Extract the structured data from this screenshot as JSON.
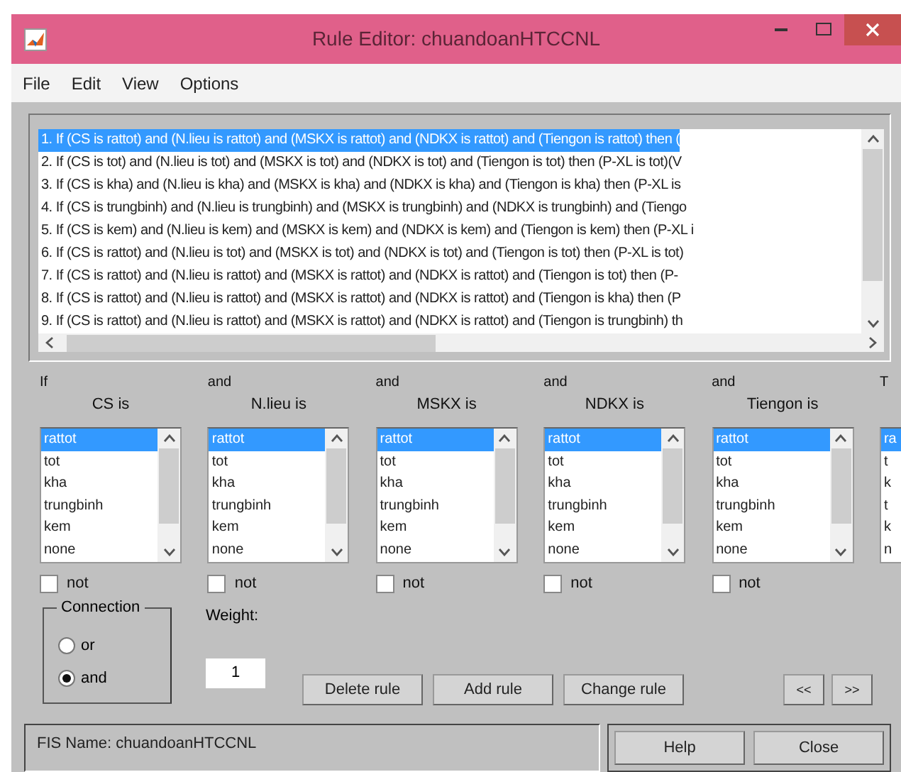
{
  "window": {
    "title": "Rule Editor: chuandoanHTCCNL"
  },
  "menu": [
    "File",
    "Edit",
    "View",
    "Options"
  ],
  "rules": [
    {
      "text": "1. If (CS is rattot) and (N.lieu is rattot) and (MSKX is rattot) and (NDKX is rattot) and (Tiengon is rattot) then (",
      "selected": true
    },
    {
      "text": "2. If (CS is tot) and (N.lieu is tot) and (MSKX is tot) and (NDKX is tot) and (Tiengon is tot) then (P-XL is tot)(V",
      "selected": false
    },
    {
      "text": "3. If (CS is kha) and (N.lieu is kha) and (MSKX is kha) and (NDKX is kha) and (Tiengon is kha) then (P-XL is",
      "selected": false
    },
    {
      "text": "4. If (CS is trungbinh) and (N.lieu is trungbinh) and (MSKX is trungbinh) and (NDKX is trungbinh) and (Tiengo",
      "selected": false
    },
    {
      "text": "5. If (CS is kem) and (N.lieu is kem) and (MSKX is kem) and (NDKX is kem) and (Tiengon is kem) then (P-XL i",
      "selected": false
    },
    {
      "text": "6. If (CS is rattot) and (N.lieu is tot) and (MSKX is tot) and (NDKX is tot) and (Tiengon is tot) then (P-XL is tot)",
      "selected": false
    },
    {
      "text": "7. If (CS is rattot) and (N.lieu is rattot) and (MSKX is rattot) and (NDKX is rattot) and (Tiengon is tot) then (P-",
      "selected": false
    },
    {
      "text": "8. If (CS is rattot) and (N.lieu is rattot) and (MSKX is rattot) and (NDKX is rattot) and (Tiengon is kha) then (P",
      "selected": false
    },
    {
      "text": "9. If (CS is rattot) and (N.lieu is rattot) and (MSKX is rattot) and (NDKX is rattot) and (Tiengon is trungbinh) th",
      "selected": false
    }
  ],
  "variables": [
    {
      "connector": "If",
      "label": "CS is",
      "options": [
        {
          "text": "rattot",
          "selected": true
        },
        {
          "text": "tot",
          "selected": false
        },
        {
          "text": "kha",
          "selected": false
        },
        {
          "text": "trungbinh",
          "selected": false
        },
        {
          "text": "kem",
          "selected": false
        },
        {
          "text": "none",
          "selected": false
        }
      ],
      "not": {
        "label": "not",
        "checked": false
      }
    },
    {
      "connector": "and",
      "label": "N.lieu is",
      "options": [
        {
          "text": "rattot",
          "selected": true
        },
        {
          "text": "tot",
          "selected": false
        },
        {
          "text": "kha",
          "selected": false
        },
        {
          "text": "trungbinh",
          "selected": false
        },
        {
          "text": "kem",
          "selected": false
        },
        {
          "text": "none",
          "selected": false
        }
      ],
      "not": {
        "label": "not",
        "checked": false
      }
    },
    {
      "connector": "and",
      "label": "MSKX is",
      "options": [
        {
          "text": "rattot",
          "selected": true
        },
        {
          "text": "tot",
          "selected": false
        },
        {
          "text": "kha",
          "selected": false
        },
        {
          "text": "trungbinh",
          "selected": false
        },
        {
          "text": "kem",
          "selected": false
        },
        {
          "text": "none",
          "selected": false
        }
      ],
      "not": {
        "label": "not",
        "checked": false
      }
    },
    {
      "connector": "and",
      "label": "NDKX is",
      "options": [
        {
          "text": "rattot",
          "selected": true
        },
        {
          "text": "tot",
          "selected": false
        },
        {
          "text": "kha",
          "selected": false
        },
        {
          "text": "trungbinh",
          "selected": false
        },
        {
          "text": "kem",
          "selected": false
        },
        {
          "text": "none",
          "selected": false
        }
      ],
      "not": {
        "label": "not",
        "checked": false
      }
    },
    {
      "connector": "and",
      "label": "Tiengon is",
      "options": [
        {
          "text": "rattot",
          "selected": true
        },
        {
          "text": "tot",
          "selected": false
        },
        {
          "text": "kha",
          "selected": false
        },
        {
          "text": "trungbinh",
          "selected": false
        },
        {
          "text": "kem",
          "selected": false
        },
        {
          "text": "none",
          "selected": false
        }
      ],
      "not": {
        "label": "not",
        "checked": false
      }
    },
    {
      "connector": "T",
      "options": [
        {
          "text": "ra",
          "selected": true
        },
        {
          "text": "t",
          "selected": false
        },
        {
          "text": "k",
          "selected": false
        },
        {
          "text": "t",
          "selected": false
        },
        {
          "text": "k",
          "selected": false
        },
        {
          "text": "n",
          "selected": false
        }
      ]
    }
  ],
  "connection": {
    "title": "Connection",
    "options": [
      {
        "label": "or",
        "selected": false
      },
      {
        "label": "and",
        "selected": true
      }
    ]
  },
  "weight": {
    "label": "Weight:",
    "value": "1"
  },
  "actions": [
    "Delete rule",
    "Add rule",
    "Change rule"
  ],
  "navigation": [
    "<<",
    ">>"
  ],
  "status": "FIS Name: chuandoanHTCCNL",
  "footer_buttons": [
    "Help",
    "Close"
  ]
}
